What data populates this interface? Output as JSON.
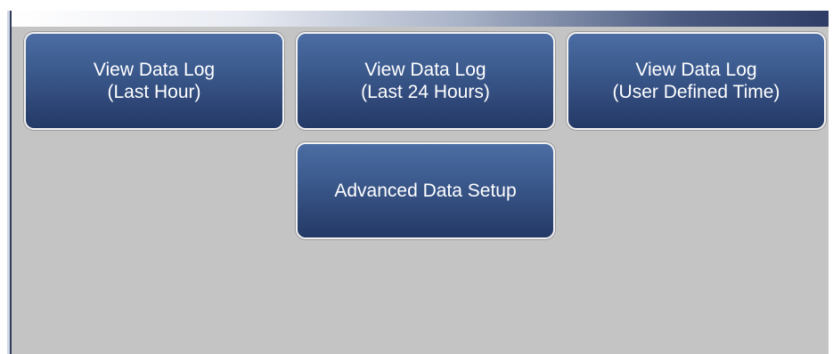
{
  "menu": {
    "buttons": [
      {
        "line1": "View Data Log",
        "line2": "(Last Hour)"
      },
      {
        "line1": "View Data Log",
        "line2": "(Last 24 Hours)"
      },
      {
        "line1": "View Data Log",
        "line2": "(User Defined Time)"
      },
      {
        "line1": "Advanced Data Setup"
      }
    ]
  },
  "colors": {
    "button_top": "#4b6da3",
    "button_bottom": "#243a66",
    "background": "#c4c4c4",
    "title_bar_dark": "#2e3d66"
  }
}
